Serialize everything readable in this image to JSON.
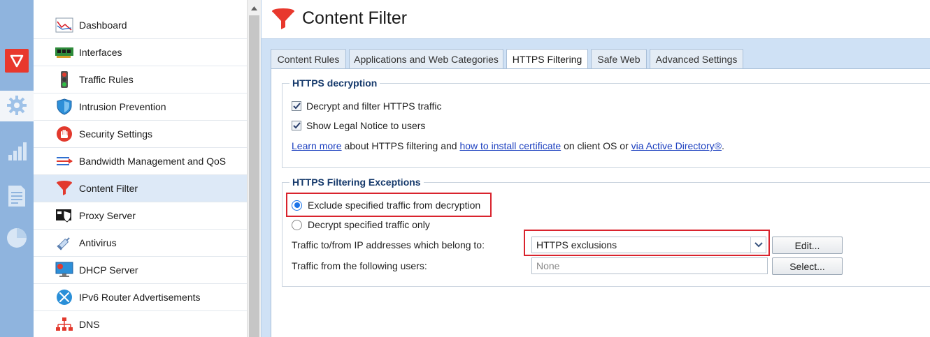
{
  "rail": {
    "items": [
      {
        "icon": "shield-logo-icon"
      },
      {
        "icon": "gear-icon"
      },
      {
        "icon": "bar-chart-icon"
      },
      {
        "icon": "log-document-icon"
      },
      {
        "icon": "pie-chart-icon"
      }
    ]
  },
  "nav": {
    "items": [
      {
        "label": "Dashboard",
        "icon": "dashboard-icon"
      },
      {
        "label": "Interfaces",
        "icon": "network-card-icon"
      },
      {
        "label": "Traffic Rules",
        "icon": "traffic-light-icon"
      },
      {
        "label": "Intrusion Prevention",
        "icon": "shield-icon"
      },
      {
        "label": "Security Settings",
        "icon": "stop-hand-icon"
      },
      {
        "label": "Bandwidth Management and QoS",
        "icon": "bandwidth-arrows-icon"
      },
      {
        "label": "Content Filter",
        "icon": "funnel-icon"
      },
      {
        "label": "Proxy Server",
        "icon": "proxy-server-icon"
      },
      {
        "label": "Antivirus",
        "icon": "syringe-icon"
      },
      {
        "label": "DHCP Server",
        "icon": "dhcp-monitor-icon"
      },
      {
        "label": "IPv6 Router Advertisements",
        "icon": "ipv6-router-icon"
      },
      {
        "label": "DNS",
        "icon": "dns-tree-icon"
      }
    ],
    "active_index": 6
  },
  "header": {
    "title": "Content Filter",
    "icon": "funnel-icon"
  },
  "tabs": [
    {
      "label": "Content Rules"
    },
    {
      "label": "Applications and Web Categories"
    },
    {
      "label": "HTTPS Filtering"
    },
    {
      "label": "Safe Web"
    },
    {
      "label": "Advanced Settings"
    }
  ],
  "active_tab": 2,
  "decryption": {
    "title": "HTTPS decryption",
    "decrypt_label": "Decrypt and filter HTTPS traffic",
    "decrypt_checked": true,
    "legal_label": "Show Legal Notice to users",
    "legal_checked": true,
    "info": {
      "learn_more": "Learn more",
      "text1": " about HTTPS filtering and ",
      "install_cert": "how to install certificate",
      "text2": " on client OS or ",
      "via_ad": "via Active Directory®",
      "text3": "."
    }
  },
  "exceptions": {
    "title": "HTTPS Filtering Exceptions",
    "exclude_label": "Exclude specified traffic from decryption",
    "decrypt_only_label": "Decrypt specified traffic only",
    "selected_mode": "exclude",
    "ip_label": "Traffic to/from IP addresses which belong to:",
    "ip_value": "HTTPS exclusions",
    "edit_label": "Edit...",
    "users_label": "Traffic from the following users:",
    "users_value": "None",
    "select_label": "Select..."
  },
  "colors": {
    "accent": "#1a73e8",
    "highlight": "#d9232d",
    "brand_red": "#e8382d"
  }
}
